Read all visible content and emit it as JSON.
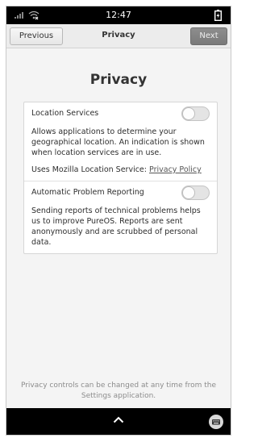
{
  "statusbar": {
    "time": "12:47",
    "icons": [
      "signal-icon",
      "wifi-icon",
      "battery-icon"
    ]
  },
  "header": {
    "previous_label": "Previous",
    "title": "Privacy",
    "next_label": "Next"
  },
  "main": {
    "title": "Privacy",
    "location": {
      "label": "Location Services",
      "enabled": false,
      "description": "Allows applications to determine your geographical location. An indication is shown when location services are in use.",
      "uses_text": "Uses Mozilla Location Service: ",
      "link_label": "Privacy Policy"
    },
    "reporting": {
      "label": "Automatic Problem Reporting",
      "enabled": false,
      "description": "Sending reports of technical problems helps us to improve PureOS. Reports are sent anonymously and are scrubbed of personal data."
    },
    "footer_note": "Privacy controls can be changed at any time from the Settings application."
  },
  "navbar": {
    "icons": [
      "chevron-up-icon",
      "keyboard-icon"
    ]
  },
  "colors": {
    "background": "#f4f4f4",
    "next_button": "#7f7f7f",
    "toggle_off": "#e4e4e4"
  }
}
